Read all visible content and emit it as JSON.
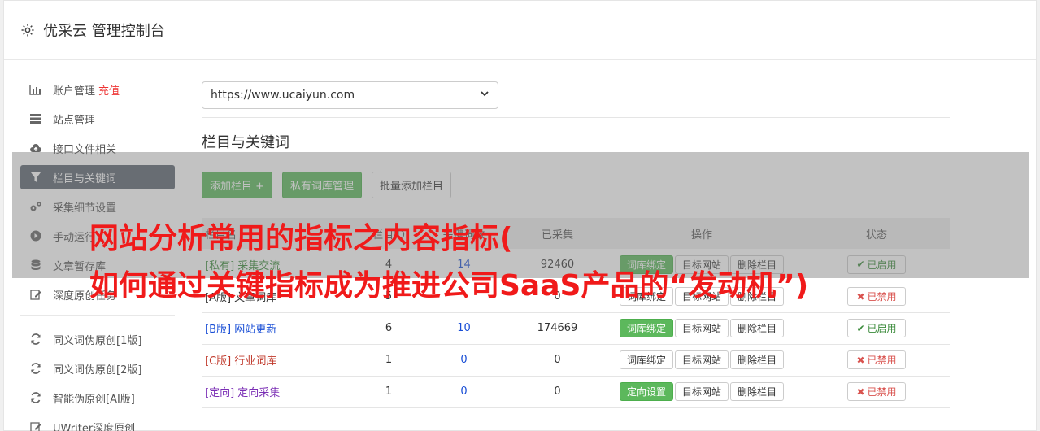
{
  "header": {
    "title": "优采云 管理控制台"
  },
  "sidebar": {
    "group1": [
      {
        "label": "账户管理",
        "extra": "充值",
        "icon": "bar-chart-icon"
      },
      {
        "label": "站点管理",
        "icon": "server-icon"
      },
      {
        "label": "接口文件相关",
        "icon": "cloud-upload-icon"
      },
      {
        "label": "栏目与关键词",
        "icon": "filter-icon",
        "active": true
      },
      {
        "label": "采集细节设置",
        "icon": "gears-icon"
      },
      {
        "label": "手动运行",
        "icon": "play-icon"
      },
      {
        "label": "文章暂存库",
        "icon": "database-icon"
      },
      {
        "label": "深度原创任务",
        "icon": "edit-icon"
      }
    ],
    "group2": [
      {
        "label": "同义词伪原创[1版]",
        "icon": "refresh-icon"
      },
      {
        "label": "同义词伪原创[2版]",
        "icon": "refresh-icon"
      },
      {
        "label": "智能伪原创[AI版]",
        "icon": "refresh-icon"
      },
      {
        "label": "UWriter深度原创",
        "icon": "edit-icon"
      }
    ]
  },
  "main": {
    "site_select": "https://www.ucaiyun.com",
    "section_title": "栏目与关键词",
    "buttons": {
      "add": "添加栏目 +",
      "private": "私有词库管理",
      "batch": "批量添加栏目"
    },
    "table": {
      "headers": [
        "栏目名",
        "栏目ID",
        "关键词数",
        "已采集",
        "操作",
        "状态"
      ],
      "rows": [
        {
          "tag": "[私有]",
          "name": "采集交流",
          "id": "4",
          "kw": "14",
          "count": "92460",
          "btn1": "词库绑定",
          "btn2": "目标网站",
          "btn3": "删除栏目",
          "status": "已启用",
          "on": true
        },
        {
          "tag": "[A版]",
          "name": "文章词库",
          "id": "5",
          "kw": "",
          "count": "0",
          "btn1": "词库绑定",
          "btn2": "目标网站",
          "btn3": "删除栏目",
          "status": "已禁用",
          "on": false
        },
        {
          "tag": "[B版]",
          "name": "网站更新",
          "id": "6",
          "kw": "10",
          "count": "174669",
          "btn1": "词库绑定",
          "btn2": "目标网站",
          "btn3": "删除栏目",
          "status": "已启用",
          "on": true
        },
        {
          "tag": "[C版]",
          "name": "行业词库",
          "id": "1",
          "kw": "0",
          "count": "0",
          "btn1": "词库绑定",
          "btn2": "目标网站",
          "btn3": "删除栏目",
          "status": "已禁用",
          "on": false
        },
        {
          "tag": "[定向]",
          "name": "定向采集",
          "id": "1",
          "kw": "0",
          "count": "0",
          "btn1": "定向设置",
          "btn2": "目标网站",
          "btn3": "删除栏目",
          "status": "已禁用",
          "on": false
        }
      ]
    }
  },
  "overlay": {
    "line1": "网站分析常用的指标之内容指标(",
    "line2": "如何通过关键指标成为推进公司SaaS产品的“发动机”)"
  },
  "colors": {
    "green": "#5cb85c",
    "active_bg": "#5b6470",
    "overlay_text": "#f01a1a"
  }
}
